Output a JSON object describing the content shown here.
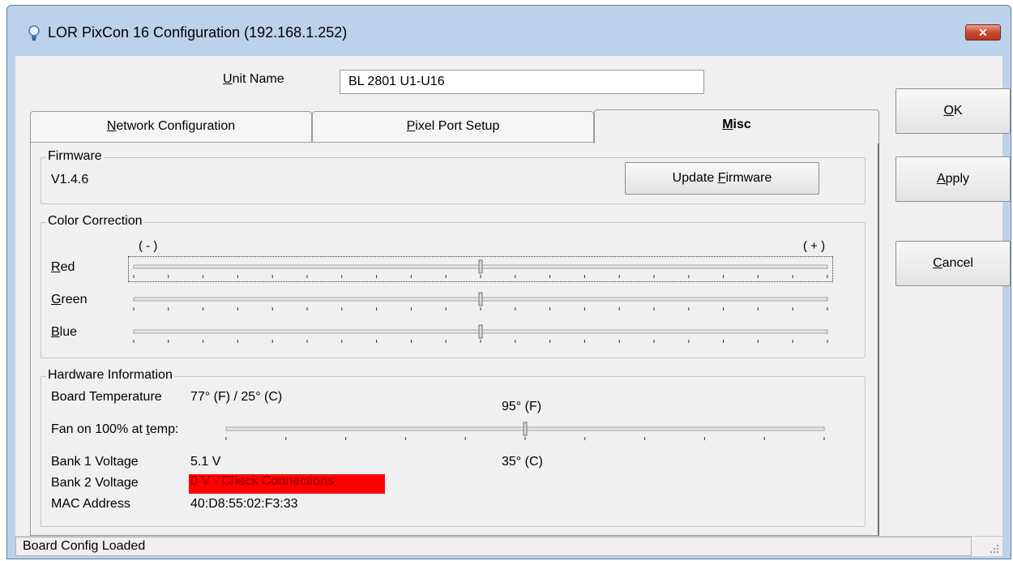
{
  "window": {
    "title": "LOR PixCon 16 Configuration (192.168.1.252)",
    "close_icon": "close-icon"
  },
  "unit": {
    "label_pre": "",
    "label_ul": "U",
    "label_post": "nit Name",
    "value": "BL 2801 U1-U16"
  },
  "buttons": {
    "ok": {
      "ul": "O",
      "rest": "K"
    },
    "apply": {
      "ul": "A",
      "rest": "pply"
    },
    "cancel": {
      "ul": "C",
      "rest": "ancel"
    }
  },
  "tabs": [
    {
      "ul": "N",
      "rest": "etwork Configuration"
    },
    {
      "ul": "P",
      "rest": "ixel Port Setup"
    },
    {
      "ul": "M",
      "rest": "isc"
    }
  ],
  "firmware": {
    "title": "Firmware",
    "version": "V1.4.6",
    "update_pre": "Update ",
    "update_ul": "F",
    "update_post": "irmware"
  },
  "color_correction": {
    "title": "Color Correction",
    "minus": "( - )",
    "plus": "( + )",
    "sliders": [
      {
        "ul": "R",
        "rest": "ed",
        "value": 0.5
      },
      {
        "ul": "G",
        "rest": "reen",
        "value": 0.5
      },
      {
        "ul": "B",
        "rest": "lue",
        "value": 0.5
      }
    ]
  },
  "hardware": {
    "title": "Hardware Information",
    "board_temp_label": "Board Temperature",
    "board_temp_value": "77° (F) / 25° (C)",
    "fan_label_pre": "Fan on 100% at ",
    "fan_label_ul": "t",
    "fan_label_post": "emp:",
    "fan_temp_f": "95° (F)",
    "fan_temp_c": "35° (C)",
    "fan_value": 0.5,
    "bank1_label": "Bank 1 Voltage",
    "bank1_value": "5.1 V",
    "bank2_label": "Bank 2 Voltage",
    "bank2_value": "0 V - Check Connections",
    "mac_label": "MAC Address",
    "mac_value": "40:D8:55:02:F3:33"
  },
  "status": {
    "text": "Board Config Loaded"
  },
  "colors": {
    "title_bg": "#bcd2ea",
    "alert": "#ff0000",
    "alert_text": "#8a0000"
  }
}
